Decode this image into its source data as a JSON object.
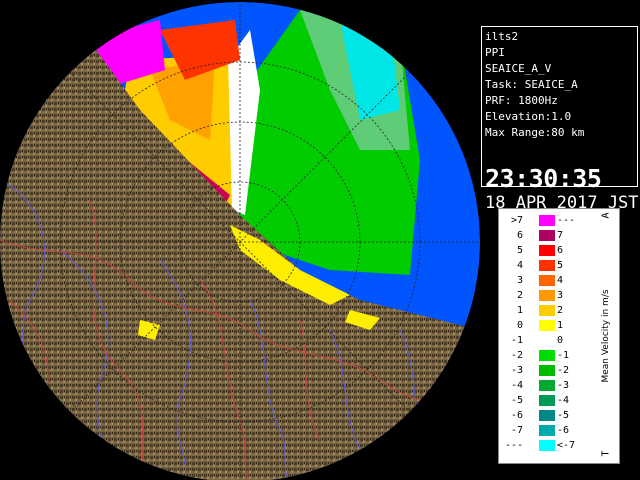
{
  "info": {
    "station": "ilts2",
    "product": "PPI",
    "moment": "SEAICE_A_V",
    "task": "Task: SEAICE_A",
    "prf": "PRF: 1800Hz",
    "elevation": "Elevation:1.0",
    "max_range": "Max Range:80 km",
    "time": "23:30:35",
    "date": "18 APR 2017 JST"
  },
  "legend": {
    "title": "Mean Velocity in m/s",
    "top_mark": "A",
    "bottom_mark": "T",
    "rows": [
      {
        "left": ">7",
        "right": "---",
        "color": "#ff00ff"
      },
      {
        "left": "6",
        "right": "7",
        "color": "#b00060"
      },
      {
        "left": "5",
        "right": "6",
        "color": "#ff0000"
      },
      {
        "left": "4",
        "right": "5",
        "color": "#ff3300"
      },
      {
        "left": "3",
        "right": "4",
        "color": "#ff6600"
      },
      {
        "left": "2",
        "right": "3",
        "color": "#ff9900"
      },
      {
        "left": "1",
        "right": "2",
        "color": "#ffcc00"
      },
      {
        "left": "0",
        "right": "1",
        "color": "#ffff00"
      },
      {
        "left": "-1",
        "right": "0",
        "color": "#ffffff"
      },
      {
        "left": "-2",
        "right": "-1",
        "color": "#00dd00"
      },
      {
        "left": "-3",
        "right": "-2",
        "color": "#00bb00"
      },
      {
        "left": "-4",
        "right": "-3",
        "color": "#00aa33"
      },
      {
        "left": "-5",
        "right": "-4",
        "color": "#009955"
      },
      {
        "left": "-6",
        "right": "-5",
        "color": "#008888"
      },
      {
        "left": "-7",
        "right": "-6",
        "color": "#00aaaa"
      },
      {
        "left": "---",
        "right": "<-7",
        "color": "#00ffff"
      }
    ]
  },
  "colors": {
    "sea": "#0055ff",
    "land": "#6b5a3a",
    "background": "#000000"
  }
}
